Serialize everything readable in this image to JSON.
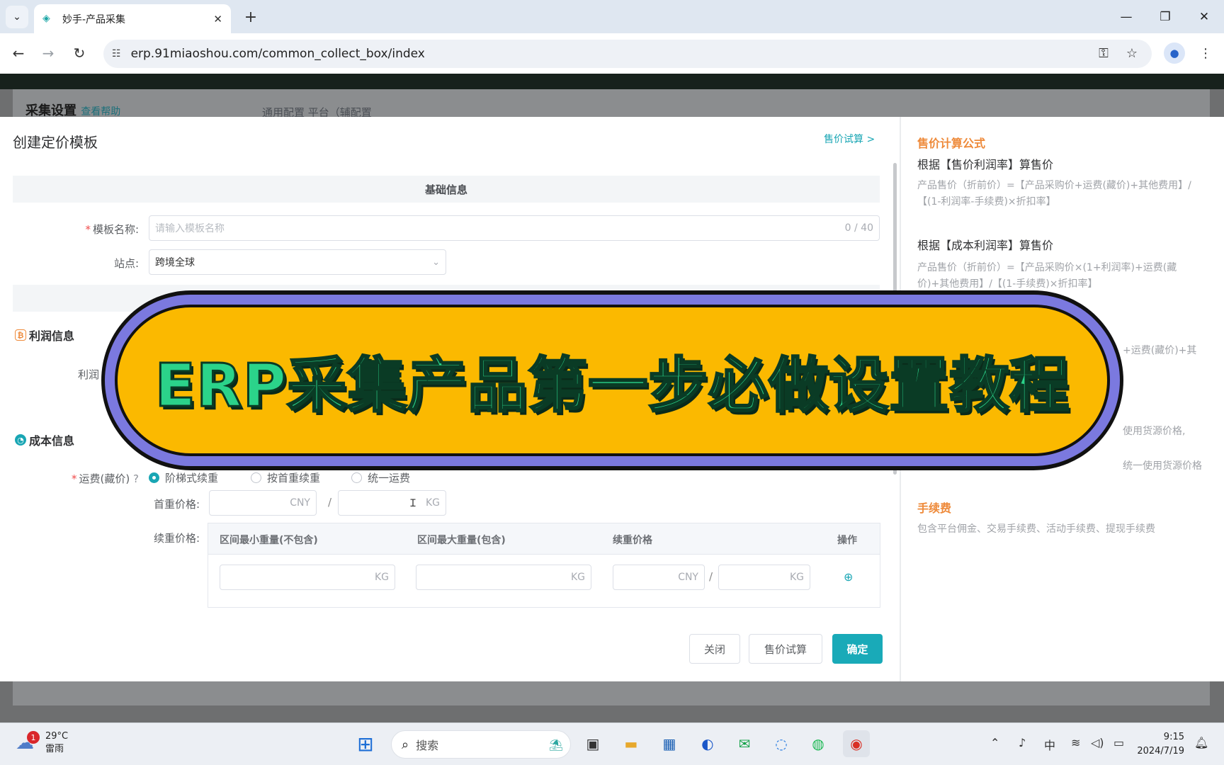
{
  "browser": {
    "tab_title": "妙手-产品采集",
    "url": "erp.91miaoshou.com/common_collect_box/index"
  },
  "background": {
    "title": "采集设置",
    "title_link": "查看帮助",
    "tabs": "通用配置      平台（辅配置"
  },
  "modal": {
    "title": "创建定价模板",
    "calc_link": "售价试算 >",
    "section_basic": "基础信息",
    "name_label": "模板名称:",
    "name_placeholder": "请输入模板名称",
    "name_counter": "0 / 40",
    "site_label": "站点:",
    "site_value": "跨境全球",
    "profit_section": "利润信息",
    "profit_label": "利润",
    "cost_section": "成本信息",
    "freight_label": "运费(藏价)",
    "freight_options": [
      "阶梯式续重",
      "按首重续重",
      "统一运费"
    ],
    "first_weight_label": "首重价格:",
    "currency": "CNY",
    "weight_unit": "KG",
    "cont_weight_label": "续重价格:",
    "table_headers": [
      "区间最小重量(不包含)",
      "区间最大重量(包含)",
      "续重价格",
      "操作"
    ],
    "buttons": {
      "close": "关闭",
      "calc": "售价试算",
      "confirm": "确定"
    }
  },
  "formula_panel": {
    "heading": "售价计算公式",
    "sub1": "根据【售价利润率】算售价",
    "text1": "产品售价（折前价）=【产品采购价+运费(藏价)+其他费用】/【(1-利润率-手续费)×折扣率】",
    "sub2": "根据【成本利润率】算售价",
    "text2": "产品售价（折前价）=【产品采购价×(1+利润率)+运费(藏价)+其他费用】/【(1-手续费)×折扣率】",
    "text3": "+运费(藏价)+其",
    "text4": "使用货源价格,",
    "text5": "统一使用货源价格",
    "fee_heading": "手续费",
    "fee_text": "包含平台佣金、交易手续费、活动手续费、提现手续费"
  },
  "banner": {
    "text": "ERP采集产品第一步必做设置教程"
  },
  "taskbar": {
    "temperature": "29°C",
    "weather": "雷雨",
    "weather_badge": "1",
    "search": "搜索",
    "ime": "中",
    "time": "9:15",
    "date": "2024/7/19"
  }
}
